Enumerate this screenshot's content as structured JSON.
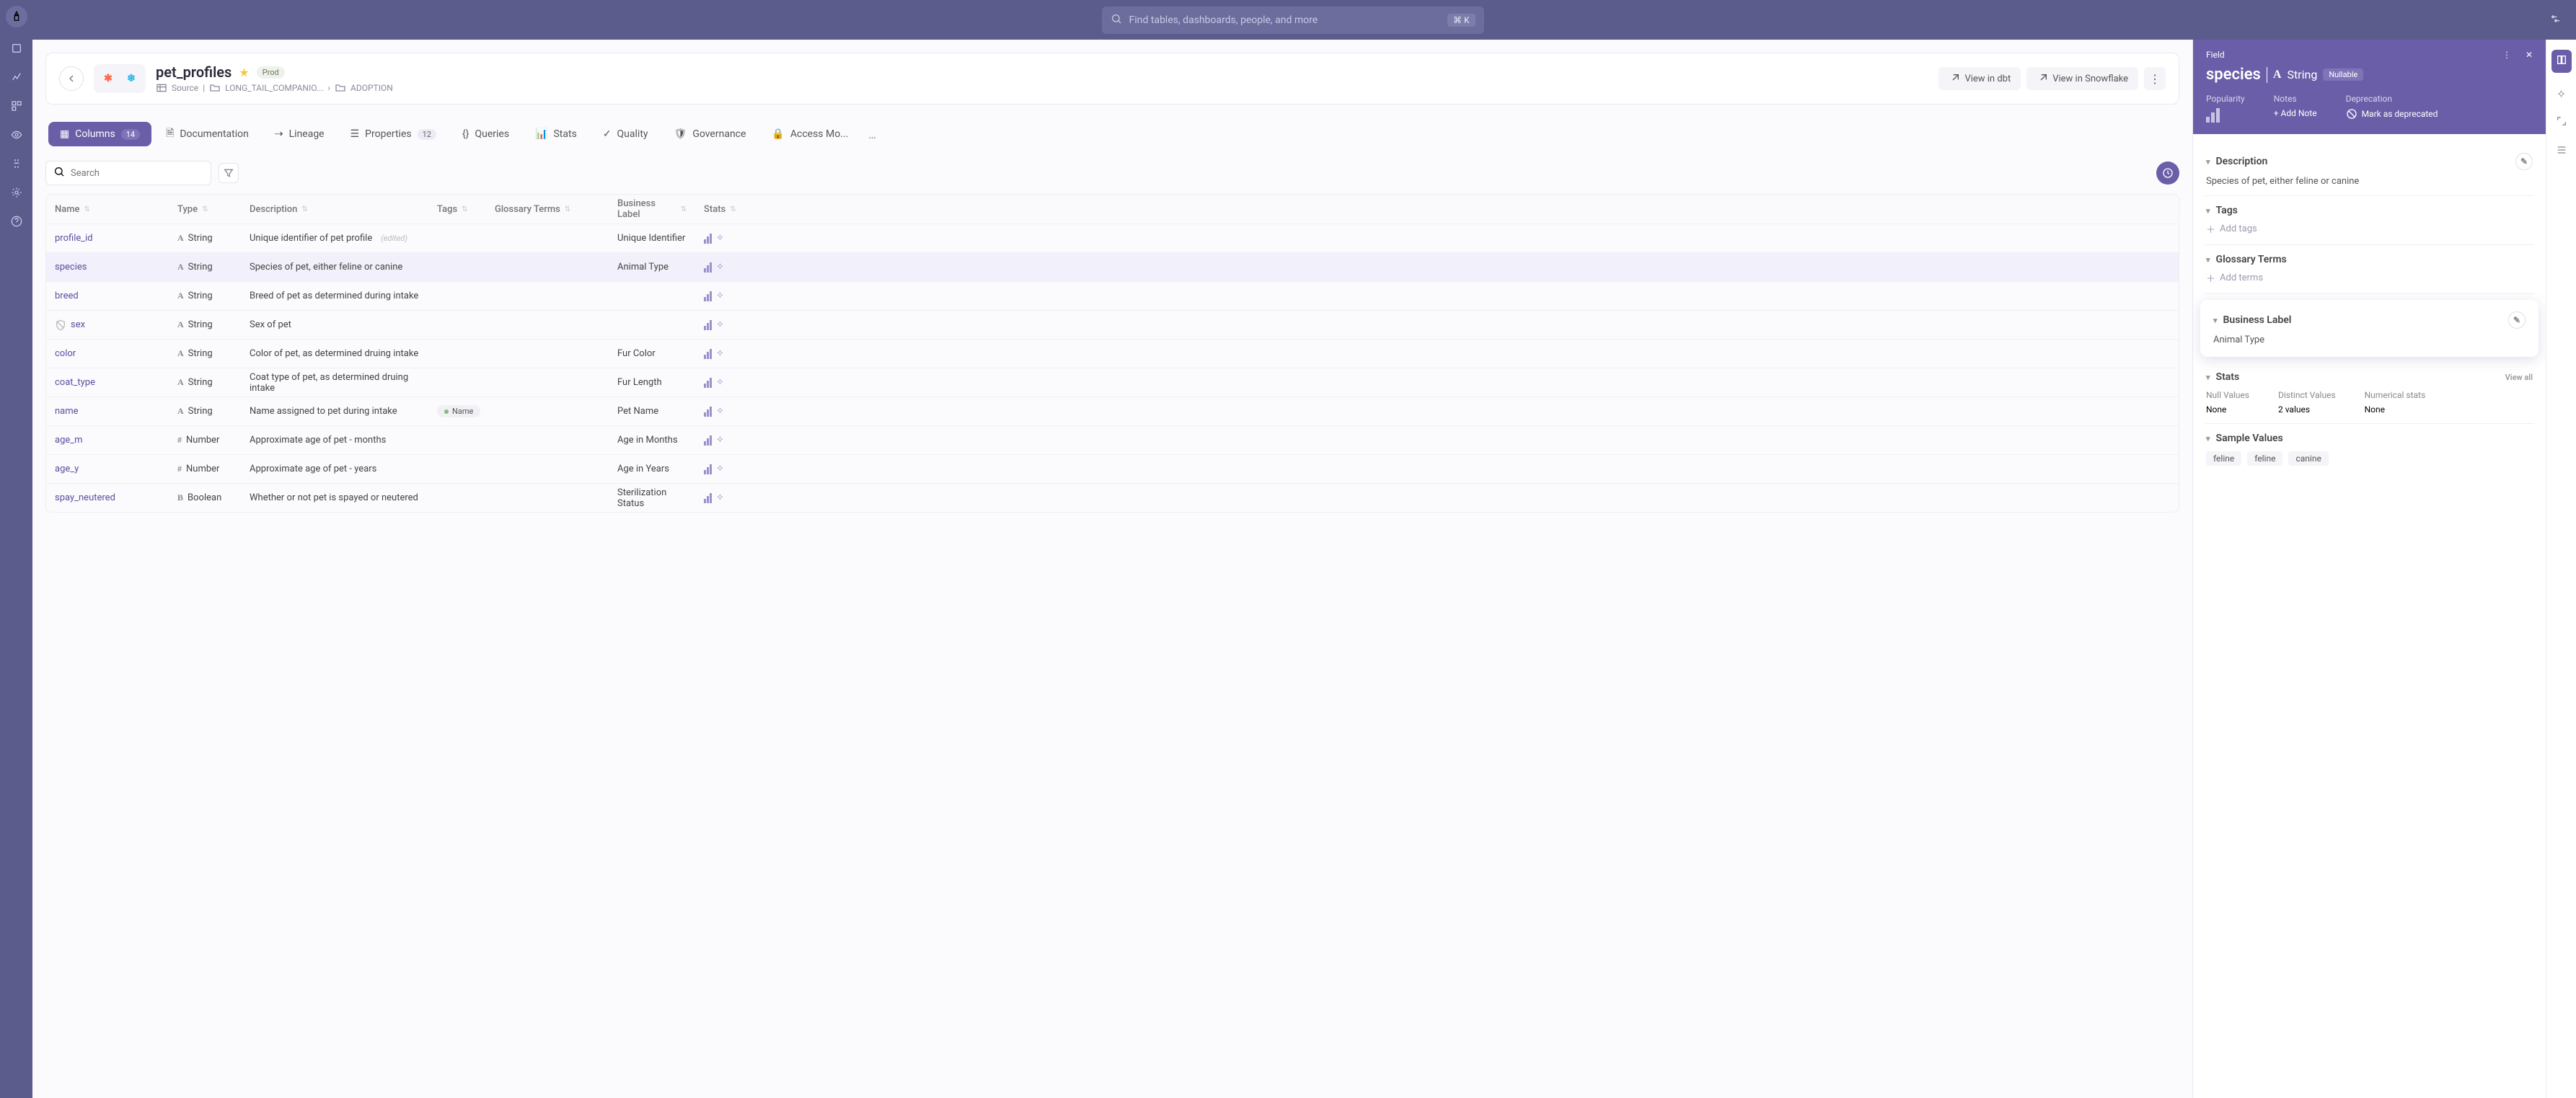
{
  "search": {
    "placeholder": "Find tables, dashboards, people, and more",
    "shortcut": "⌘ K"
  },
  "header": {
    "title": "pet_profiles",
    "badge": "Prod",
    "source_label": "Source",
    "path": [
      "LONG_TAIL_COMPANIO...",
      "ADOPTION"
    ],
    "actions": {
      "dbt": "View in dbt",
      "snowflake": "View in Snowflake"
    }
  },
  "tabs": [
    {
      "label": "Columns",
      "count": "14",
      "active": true
    },
    {
      "label": "Documentation"
    },
    {
      "label": "Lineage"
    },
    {
      "label": "Properties",
      "count": "12"
    },
    {
      "label": "Queries"
    },
    {
      "label": "Stats"
    },
    {
      "label": "Quality"
    },
    {
      "label": "Governance"
    },
    {
      "label": "Access Mo..."
    }
  ],
  "column_filter": {
    "placeholder": "Search"
  },
  "columns_header": [
    "Name",
    "Type",
    "Description",
    "Tags",
    "Glossary Terms",
    "Business Label",
    "Stats"
  ],
  "rows": [
    {
      "name": "profile_id",
      "type": "String",
      "type_ic": "A",
      "desc": "Unique identifier of pet profile",
      "edited": "(edited)",
      "biz": "Unique Identifier"
    },
    {
      "name": "species",
      "type": "String",
      "type_ic": "A",
      "desc": "Species of pet, either feline or canine",
      "biz": "Animal Type",
      "selected": true
    },
    {
      "name": "breed",
      "type": "String",
      "type_ic": "A",
      "desc": "Breed of pet as determined during intake"
    },
    {
      "name": "sex",
      "type": "String",
      "type_ic": "A",
      "desc": "Sex of pet",
      "shield": true
    },
    {
      "name": "color",
      "type": "String",
      "type_ic": "A",
      "desc": "Color of pet, as determined druing intake",
      "biz": "Fur Color"
    },
    {
      "name": "coat_type",
      "type": "String",
      "type_ic": "A",
      "desc": "Coat type of pet, as determined druing intake",
      "biz": "Fur Length"
    },
    {
      "name": "name",
      "type": "String",
      "type_ic": "A",
      "desc": "Name assigned to pet during intake",
      "tag": "Name",
      "biz": "Pet Name"
    },
    {
      "name": "age_m",
      "type": "Number",
      "type_ic": "#",
      "desc": "Approximate age of pet - months",
      "biz": "Age in Months"
    },
    {
      "name": "age_y",
      "type": "Number",
      "type_ic": "#",
      "desc": "Approximate age of pet - years",
      "biz": "Age in Years"
    },
    {
      "name": "spay_neutered",
      "type": "Boolean",
      "type_ic": "B",
      "desc": "Whether or not pet is spayed or neutered",
      "biz": "Sterilization Status"
    }
  ],
  "side": {
    "field_label": "Field",
    "name": "species",
    "type": "String",
    "nullable": "Nullable",
    "popularity": "Popularity",
    "notes": {
      "label": "Notes",
      "action": "+ Add Note"
    },
    "deprecation": {
      "label": "Deprecation",
      "action": "Mark as deprecated"
    },
    "description": {
      "title": "Description",
      "body": "Species of pet, either feline or canine"
    },
    "tags": {
      "title": "Tags",
      "add": "Add tags"
    },
    "glossary": {
      "title": "Glossary Terms",
      "add": "Add terms"
    },
    "business": {
      "title": "Business Label",
      "value": "Animal Type"
    },
    "stats": {
      "title": "Stats",
      "view_all": "View all",
      "null": {
        "label": "Null Values",
        "value": "None"
      },
      "distinct": {
        "label": "Distinct Values",
        "value": "2 values"
      },
      "numerical": {
        "label": "Numerical stats",
        "value": "None"
      }
    },
    "samples": {
      "title": "Sample Values",
      "values": [
        "feline",
        "feline",
        "canine"
      ]
    }
  }
}
